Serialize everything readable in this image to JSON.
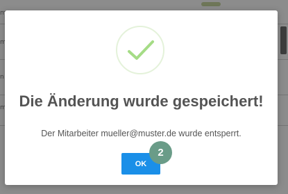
{
  "background": {
    "row_labels": [
      "m",
      "m",
      "n",
      "m"
    ]
  },
  "modal": {
    "icon": "checkmark-icon",
    "title": "Die Änderung wurde gespeichert!",
    "message": "Der Mitarbeiter mueller@muster.de wurde entsperrt.",
    "ok_label": "OK",
    "accent_color": "#1a8fe8",
    "success_color": "#a5dc86"
  },
  "annotation": {
    "step": "2",
    "color": "#6a9c88"
  }
}
